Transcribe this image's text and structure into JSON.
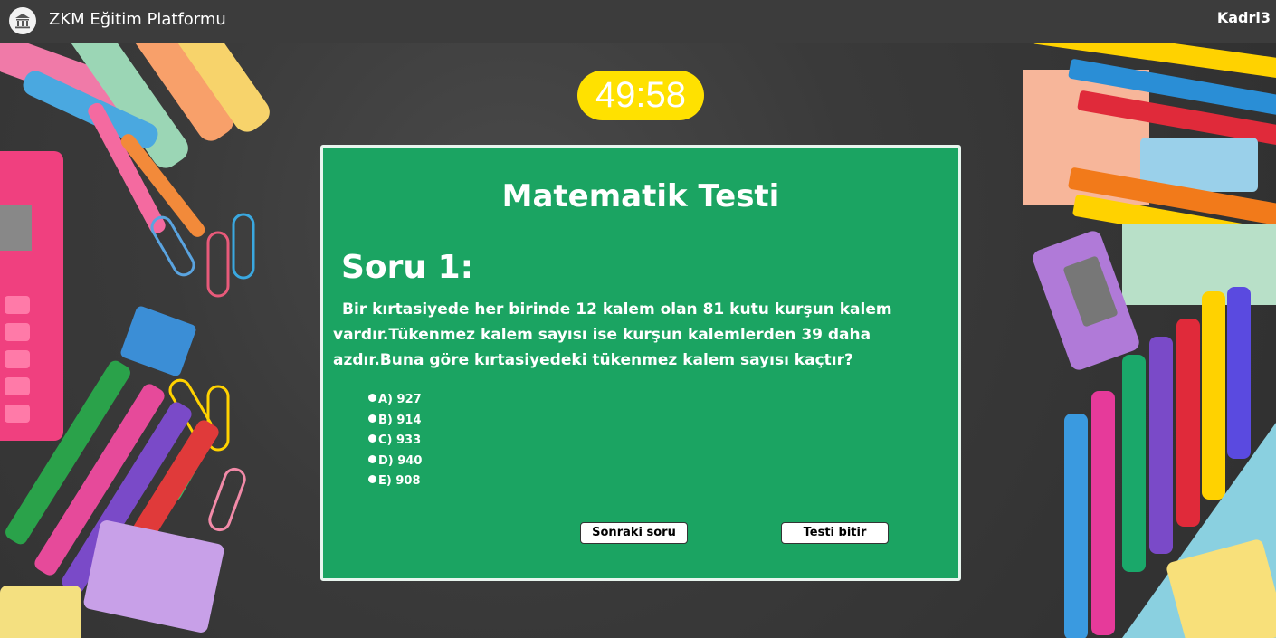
{
  "header": {
    "brand": "ZKM Eğitim Platformu",
    "username": "Kadri3",
    "logo_icon": "bank-building-icon"
  },
  "timer": {
    "value": "49:58",
    "background_color": "#ffe100"
  },
  "quiz": {
    "title": "Matematik Testi",
    "question_number": "Soru 1:",
    "question_text": "Bir kırtasiyede her birinde 12 kalem olan 81 kutu kurşun kalem vardır.Tükenmez kalem sayısı ise kurşun kalemlerden 39 daha azdır.Buna göre kırtasiyedeki tükenmez kalem sayısı kaçtır?",
    "options": [
      {
        "label": "A) 927"
      },
      {
        "label": "B) 914"
      },
      {
        "label": "C) 933"
      },
      {
        "label": "D) 940"
      },
      {
        "label": "E) 908"
      }
    ],
    "next_button": "Sonraki soru",
    "finish_button": "Testi bitir",
    "card_color": "#1ba462"
  }
}
